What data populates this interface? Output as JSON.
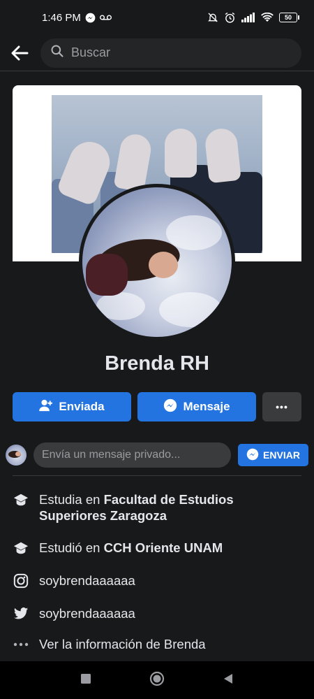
{
  "status": {
    "time": "1:46 PM",
    "battery": "50"
  },
  "search": {
    "placeholder": "Buscar"
  },
  "profile": {
    "name": "Brenda RH"
  },
  "actions": {
    "sent_label": "Enviada",
    "message_label": "Mensaje",
    "more_label": "•••"
  },
  "message": {
    "placeholder": "Envía un mensaje privado...",
    "send_label": "ENVIAR"
  },
  "info": {
    "study_prefix": "Estudia en ",
    "study_place": "Facultad de Estudios Superiores Zaragoza",
    "studied_prefix": "Estudió en ",
    "studied_place": "CCH Oriente UNAM",
    "instagram": "soybrendaaaaaa",
    "twitter": "soybrendaaaaaa",
    "see_info": "Ver la información de Brenda"
  },
  "colors": {
    "background": "#18191a",
    "accent": "#2374e1",
    "secondary_button": "#3a3b3c"
  }
}
